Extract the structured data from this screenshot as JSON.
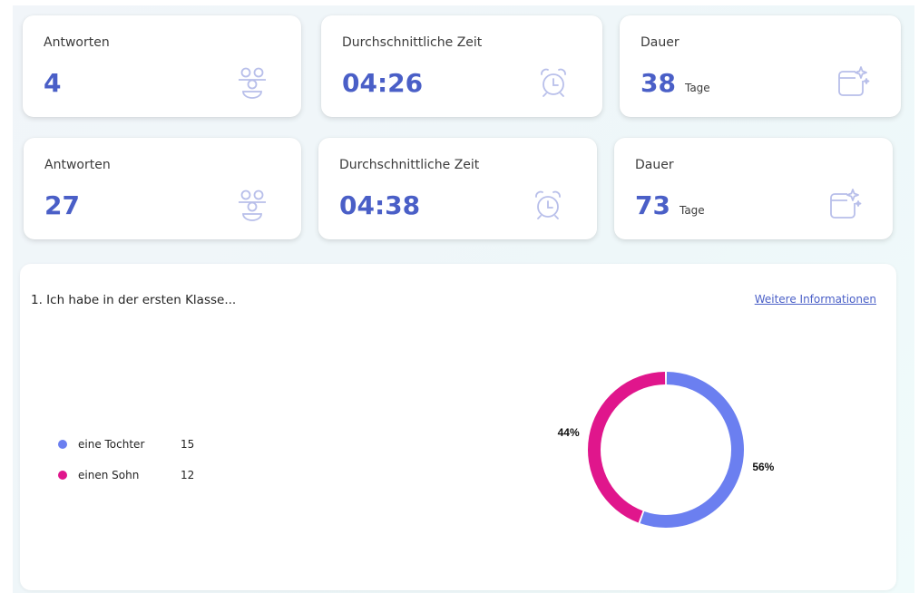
{
  "stats_rows": [
    [
      {
        "label": "Antworten",
        "value": "4",
        "unit": "",
        "icon": "people-icon"
      },
      {
        "label": "Durchschnittliche Zeit",
        "value": "04:26",
        "unit": "",
        "icon": "alarm-clock-icon"
      },
      {
        "label": "Dauer",
        "value": "38",
        "unit": "Tage",
        "icon": "calendar-sparkle-icon"
      }
    ],
    [
      {
        "label": "Antworten",
        "value": "27",
        "unit": "",
        "icon": "people-icon"
      },
      {
        "label": "Durchschnittliche Zeit",
        "value": "04:38",
        "unit": "",
        "icon": "alarm-clock-icon"
      },
      {
        "label": "Dauer",
        "value": "73",
        "unit": "Tage",
        "icon": "calendar-sparkle-icon"
      }
    ]
  ],
  "question": {
    "title": "1. Ich habe in der ersten Klasse...",
    "more_link": "Weitere Informationen"
  },
  "colors": {
    "accent": "#4a5fc7",
    "icon": "#b8bfea",
    "series_1": "#6b7ff0",
    "series_2": "#e0168c"
  },
  "chart_data": {
    "type": "pie",
    "categories": [
      "eine Tochter",
      "einen Sohn"
    ],
    "values": [
      15,
      12
    ],
    "percent_labels": [
      "56%",
      "44%"
    ],
    "colors": [
      "#6b7ff0",
      "#e0168c"
    ],
    "donut": true,
    "legend": "left"
  }
}
